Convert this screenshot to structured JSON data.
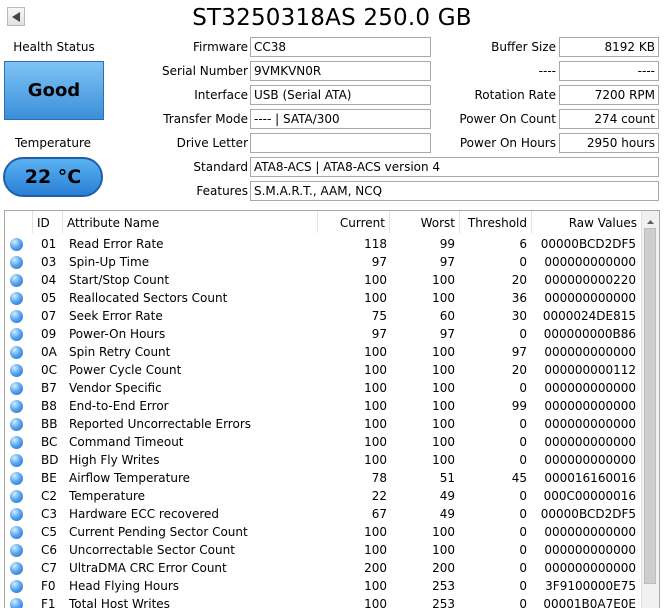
{
  "title": "ST3250318AS 250.0 GB",
  "health": {
    "label": "Health Status",
    "value": "Good",
    "color": "#4aa3ea"
  },
  "temperature": {
    "label": "Temperature",
    "value": "22 °C",
    "color": "#3b93e3"
  },
  "fields": {
    "firmware": {
      "label": "Firmware",
      "value": "CC38"
    },
    "serial": {
      "label": "Serial Number",
      "value": "9VMKVN0R"
    },
    "interface": {
      "label": "Interface",
      "value": "USB (Serial ATA)"
    },
    "transfer_mode": {
      "label": "Transfer Mode",
      "value": "---- | SATA/300"
    },
    "drive_letter": {
      "label": "Drive Letter",
      "value": ""
    },
    "standard": {
      "label": "Standard",
      "value": "ATA8-ACS | ATA8-ACS version 4"
    },
    "features": {
      "label": "Features",
      "value": "S.M.A.R.T., AAM, NCQ"
    },
    "buffer_size": {
      "label": "Buffer Size",
      "value": "8192 KB"
    },
    "nv_cache": {
      "label": "----",
      "value": "----"
    },
    "rotation_rate": {
      "label": "Rotation Rate",
      "value": "7200 RPM"
    },
    "power_on_count": {
      "label": "Power On Count",
      "value": "274 count"
    },
    "power_on_hours": {
      "label": "Power On Hours",
      "value": "2950 hours"
    }
  },
  "table": {
    "columns": [
      "ID",
      "Attribute Name",
      "Current",
      "Worst",
      "Threshold",
      "Raw Values"
    ],
    "rows": [
      {
        "id": "01",
        "name": "Read Error Rate",
        "current": "118",
        "worst": "99",
        "threshold": "6",
        "raw": "00000BCD2DF5"
      },
      {
        "id": "03",
        "name": "Spin-Up Time",
        "current": "97",
        "worst": "97",
        "threshold": "0",
        "raw": "000000000000"
      },
      {
        "id": "04",
        "name": "Start/Stop Count",
        "current": "100",
        "worst": "100",
        "threshold": "20",
        "raw": "000000000220"
      },
      {
        "id": "05",
        "name": "Reallocated Sectors Count",
        "current": "100",
        "worst": "100",
        "threshold": "36",
        "raw": "000000000000"
      },
      {
        "id": "07",
        "name": "Seek Error Rate",
        "current": "75",
        "worst": "60",
        "threshold": "30",
        "raw": "0000024DE815"
      },
      {
        "id": "09",
        "name": "Power-On Hours",
        "current": "97",
        "worst": "97",
        "threshold": "0",
        "raw": "000000000B86"
      },
      {
        "id": "0A",
        "name": "Spin Retry Count",
        "current": "100",
        "worst": "100",
        "threshold": "97",
        "raw": "000000000000"
      },
      {
        "id": "0C",
        "name": "Power Cycle Count",
        "current": "100",
        "worst": "100",
        "threshold": "20",
        "raw": "000000000112"
      },
      {
        "id": "B7",
        "name": "Vendor Specific",
        "current": "100",
        "worst": "100",
        "threshold": "0",
        "raw": "000000000000"
      },
      {
        "id": "B8",
        "name": "End-to-End Error",
        "current": "100",
        "worst": "100",
        "threshold": "99",
        "raw": "000000000000"
      },
      {
        "id": "BB",
        "name": "Reported Uncorrectable Errors",
        "current": "100",
        "worst": "100",
        "threshold": "0",
        "raw": "000000000000"
      },
      {
        "id": "BC",
        "name": "Command Timeout",
        "current": "100",
        "worst": "100",
        "threshold": "0",
        "raw": "000000000000"
      },
      {
        "id": "BD",
        "name": "High Fly Writes",
        "current": "100",
        "worst": "100",
        "threshold": "0",
        "raw": "000000000000"
      },
      {
        "id": "BE",
        "name": "Airflow Temperature",
        "current": "78",
        "worst": "51",
        "threshold": "45",
        "raw": "000016160016"
      },
      {
        "id": "C2",
        "name": "Temperature",
        "current": "22",
        "worst": "49",
        "threshold": "0",
        "raw": "000C00000016"
      },
      {
        "id": "C3",
        "name": "Hardware ECC recovered",
        "current": "67",
        "worst": "49",
        "threshold": "0",
        "raw": "00000BCD2DF5"
      },
      {
        "id": "C5",
        "name": "Current Pending Sector Count",
        "current": "100",
        "worst": "100",
        "threshold": "0",
        "raw": "000000000000"
      },
      {
        "id": "C6",
        "name": "Uncorrectable Sector Count",
        "current": "100",
        "worst": "100",
        "threshold": "0",
        "raw": "000000000000"
      },
      {
        "id": "C7",
        "name": "UltraDMA CRC Error Count",
        "current": "200",
        "worst": "200",
        "threshold": "0",
        "raw": "000000000000"
      },
      {
        "id": "F0",
        "name": "Head Flying Hours",
        "current": "100",
        "worst": "253",
        "threshold": "0",
        "raw": "3F9100000E75"
      },
      {
        "id": "F1",
        "name": "Total Host Writes",
        "current": "100",
        "worst": "253",
        "threshold": "0",
        "raw": "00001B0A7E0E"
      }
    ]
  },
  "icons": {
    "back": "left-arrow-icon",
    "status": "status-dot-icon"
  }
}
